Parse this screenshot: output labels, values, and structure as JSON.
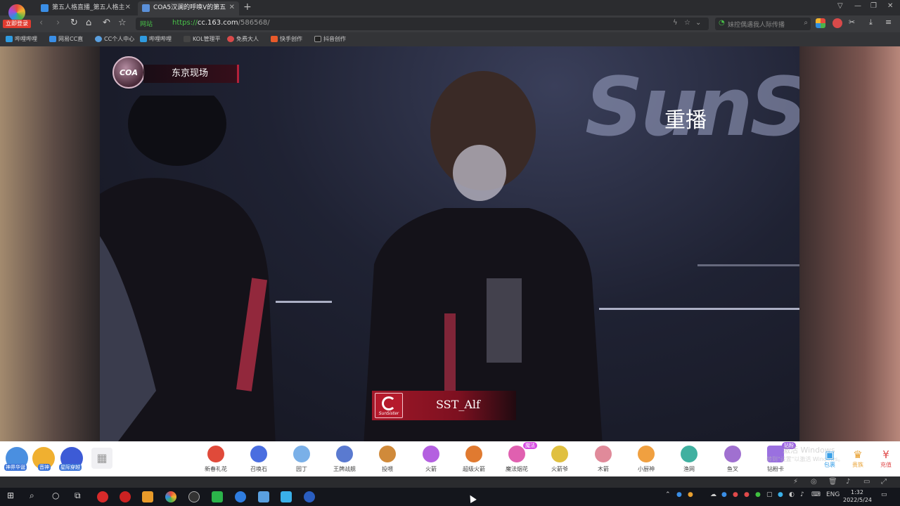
{
  "browser": {
    "login_badge": "立即登录",
    "tabs": [
      {
        "title": "第五人格直播_第五人格主",
        "active": false
      },
      {
        "title": "COA5汉澜的呼唤V的第五",
        "active": true
      }
    ],
    "new_tab": "+",
    "address": {
      "secure_label": "网站",
      "url_protocol": "https://",
      "url_host": "cc.163.com",
      "url_path": "/586568/"
    },
    "search_placeholder": "妹控偶遇我人际传播",
    "bookmarks": [
      "哔哩哔哩",
      "网易CC直",
      "CC个人中心",
      "哔哩哔哩",
      "KOL管理平",
      "免费大人",
      "快手创作",
      "抖音创作"
    ]
  },
  "stream": {
    "badge": "COA",
    "location": "东京现场",
    "replay": "重播",
    "sponsor_wall_text": "SunS",
    "nameplate": {
      "team_logo_text": "SunSister",
      "player_name": "SST_Alf"
    }
  },
  "giftbar": {
    "quick": [
      {
        "label": "神界华诞",
        "color": "#4a8fe0"
      },
      {
        "label": "音神",
        "color": "#f0b030"
      },
      {
        "label": "星际穿越",
        "color": "#3d5bd6"
      }
    ],
    "gifts": [
      {
        "name": "新春礼花",
        "color": "#e04a3a",
        "tag": ""
      },
      {
        "name": "召唤石",
        "color": "#4a6ee0",
        "tag": ""
      },
      {
        "name": "园丁",
        "color": "#7ab0e8",
        "tag": ""
      },
      {
        "name": "王牌战舰",
        "color": "#5a7ad0",
        "tag": ""
      },
      {
        "name": "投喂",
        "color": "#d08a3a",
        "tag": ""
      },
      {
        "name": "火箭",
        "color": "#b460e0",
        "tag": ""
      },
      {
        "name": "超级火箭",
        "color": "#e07a30",
        "tag": ""
      },
      {
        "name": "魔法烟花",
        "color": "#e060b0",
        "tag": "魔法"
      },
      {
        "name": "火箭爷",
        "color": "#e0c040",
        "tag": ""
      },
      {
        "name": "木箭",
        "color": "#e08a9a",
        "tag": ""
      },
      {
        "name": "小厨神",
        "color": "#f0a040",
        "tag": ""
      },
      {
        "name": "渔网",
        "color": "#40b0a0",
        "tag": ""
      },
      {
        "name": "鱼叉",
        "color": "#a070d0",
        "tag": ""
      },
      {
        "name": "钻粉卡",
        "color": "#9a70e0",
        "tag": "钻粉"
      }
    ],
    "actions": [
      {
        "label": "包裹",
        "icon": "▣",
        "color": "#3aa0e8"
      },
      {
        "label": "贵族",
        "icon": "♛",
        "color": "#e8a030"
      },
      {
        "label": "充值",
        "icon": "¥",
        "color": "#e04a4a"
      }
    ],
    "watermark_line1": "激活 Windows",
    "watermark_line2": "转到\"设置\"以激活 Windows。"
  },
  "taskbar": {
    "language": "ENG",
    "time": "1:32",
    "date": "2022/5/24"
  }
}
